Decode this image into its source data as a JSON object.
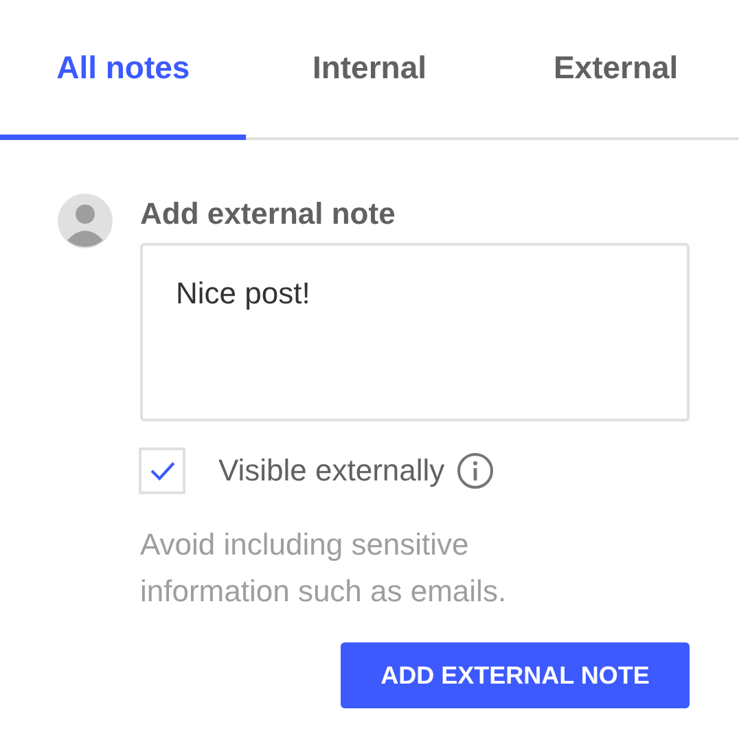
{
  "tabs": [
    {
      "label": "All notes",
      "selected": true
    },
    {
      "label": "Internal",
      "selected": false
    },
    {
      "label": "External",
      "selected": false
    }
  ],
  "note_form": {
    "title": "Add external note",
    "value": "Nice post!",
    "visible_externally": {
      "label": "Visible externally",
      "checked": true
    },
    "helper_text": "Avoid including sensitive information such as emails.",
    "submit_button": "ADD EXTERNAL NOTE"
  }
}
